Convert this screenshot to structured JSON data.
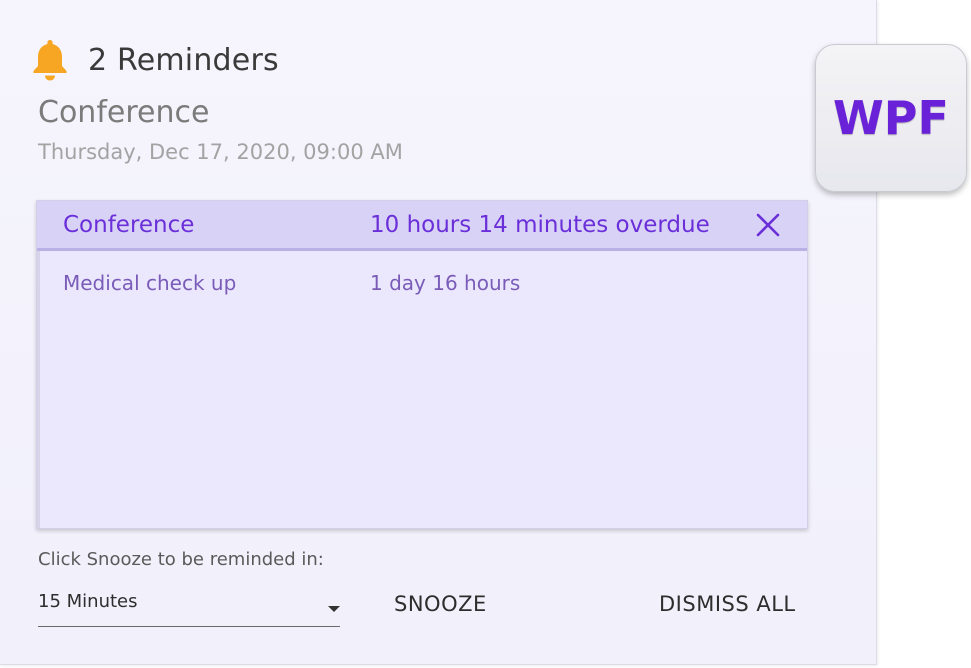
{
  "header": {
    "icon": "bell-icon",
    "title": "2 Reminders"
  },
  "current": {
    "subject": "Conference",
    "datetime": "Thursday, Dec 17, 2020, 09:00 AM"
  },
  "reminders": [
    {
      "name": "Conference",
      "due": "10 hours 14 minutes overdue",
      "selected": true
    },
    {
      "name": "Medical check up",
      "due": "1 day 16 hours",
      "selected": false
    }
  ],
  "footer": {
    "snooze_label": "Click Snooze to be reminded in:",
    "snooze_value": "15 Minutes",
    "snooze_button": "SNOOZE",
    "dismiss_all_button": "DISMISS ALL"
  },
  "badge": {
    "text": "WPF"
  },
  "colors": {
    "accent": "#6a2fd8",
    "bell": "#f6a623",
    "selected_row": "#d9d2f7",
    "list_background": "#ebe8fd"
  }
}
